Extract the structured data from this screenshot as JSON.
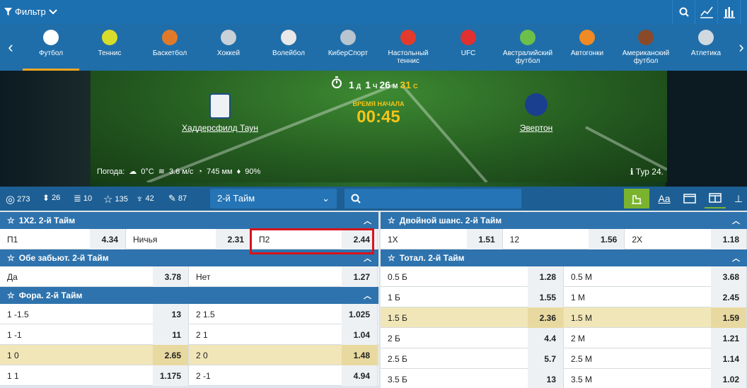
{
  "topbar": {
    "filter_label": "Фильтр"
  },
  "sports": [
    {
      "label": "Футбол",
      "color": "#ffffff"
    },
    {
      "label": "Теннис",
      "color": "#d7dd2a"
    },
    {
      "label": "Баскетбол",
      "color": "#e07a2a"
    },
    {
      "label": "Хоккей",
      "color": "#c8d0d8"
    },
    {
      "label": "Волейбол",
      "color": "#e8e8e8"
    },
    {
      "label": "КиберСпорт",
      "color": "#b8c4d0"
    },
    {
      "label": "Настольный теннис",
      "color": "#e23b2e"
    },
    {
      "label": "UFC",
      "color": "#e03030"
    },
    {
      "label": "Австралийский футбол",
      "color": "#6cc04a"
    },
    {
      "label": "Автогонки",
      "color": "#f08a24"
    },
    {
      "label": "Американский футбол",
      "color": "#8a4a2a"
    },
    {
      "label": "Атлетика",
      "color": "#d0d8e0"
    }
  ],
  "match": {
    "timer": {
      "d": "1",
      "d_unit": "Д",
      "h": "1",
      "h_unit": "Ч",
      "m": "26",
      "m_unit": "М",
      "s": "31",
      "s_unit": "С"
    },
    "home": "Хаддерсфилд Таун",
    "away": "Эвертон",
    "kickoff_label": "ВРЕМЯ НАЧАЛА",
    "kickoff_time": "00:45",
    "weather_label": "Погода:",
    "temp": "0°C",
    "wind": "3.6 м/с",
    "pressure": "745 мм",
    "humidity": "90%",
    "round": "Тур 24."
  },
  "toolbar": {
    "s1": "273",
    "s2": "26",
    "s3": "10",
    "s4": "135",
    "s5": "42",
    "s6": "87",
    "period": "2-й Тайм",
    "aa": "Aa"
  },
  "left": [
    {
      "title": "1X2. 2-й Тайм",
      "rows": [
        {
          "hl": false,
          "cells": [
            [
              "П1",
              "4.34"
            ],
            [
              "Ничья",
              "2.31"
            ],
            [
              "П2",
              "2.44"
            ]
          ]
        }
      ]
    },
    {
      "title": "Обе забьют. 2-й Тайм",
      "rows": [
        {
          "hl": false,
          "cells": [
            [
              "Да",
              "3.78"
            ],
            [
              "Нет",
              "1.27"
            ]
          ]
        }
      ]
    },
    {
      "title": "Фора. 2-й Тайм",
      "rows": [
        {
          "hl": false,
          "cells": [
            [
              "1 -1.5",
              "13"
            ],
            [
              "2 1.5",
              "1.025"
            ]
          ]
        },
        {
          "hl": false,
          "cells": [
            [
              "1 -1",
              "11"
            ],
            [
              "2 1",
              "1.04"
            ]
          ]
        },
        {
          "hl": true,
          "cells": [
            [
              "1 0",
              "2.65"
            ],
            [
              "2 0",
              "1.48"
            ]
          ]
        },
        {
          "hl": false,
          "cells": [
            [
              "1 1",
              "1.175"
            ],
            [
              "2 -1",
              "4.94"
            ]
          ]
        }
      ]
    }
  ],
  "right": [
    {
      "title": "Двойной шанс. 2-й Тайм",
      "rows": [
        {
          "hl": false,
          "cells": [
            [
              "1X",
              "1.51"
            ],
            [
              "12",
              "1.56"
            ],
            [
              "2X",
              "1.18"
            ]
          ]
        }
      ]
    },
    {
      "title": "Тотал. 2-й Тайм",
      "rows": [
        {
          "hl": false,
          "cells": [
            [
              "0.5 Б",
              "1.28"
            ],
            [
              "0.5 М",
              "3.68"
            ]
          ]
        },
        {
          "hl": false,
          "cells": [
            [
              "1 Б",
              "1.55"
            ],
            [
              "1 М",
              "2.45"
            ]
          ]
        },
        {
          "hl": true,
          "cells": [
            [
              "1.5 Б",
              "2.36"
            ],
            [
              "1.5 М",
              "1.59"
            ]
          ]
        },
        {
          "hl": false,
          "cells": [
            [
              "2 Б",
              "4.4"
            ],
            [
              "2 М",
              "1.21"
            ]
          ]
        },
        {
          "hl": false,
          "cells": [
            [
              "2.5 Б",
              "5.7"
            ],
            [
              "2.5 М",
              "1.14"
            ]
          ]
        },
        {
          "hl": false,
          "cells": [
            [
              "3.5 Б",
              "13"
            ],
            [
              "3.5 М",
              "1.02"
            ]
          ]
        }
      ]
    }
  ]
}
